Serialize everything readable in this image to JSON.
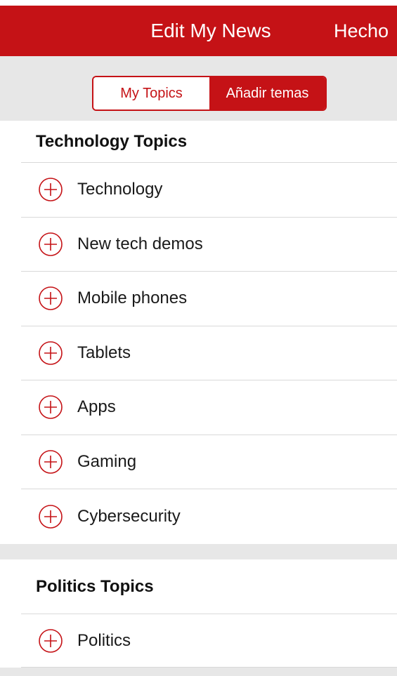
{
  "navbar": {
    "title": "Edit My News",
    "done_label": "Hecho",
    "color": "#c51216"
  },
  "segmented": {
    "my_topics": "My Topics",
    "add_topics": "Añadir temas",
    "selected": "Añadir temas"
  },
  "sections": [
    {
      "title": "Technology Topics",
      "items": [
        {
          "label": "Technology",
          "icon": "plus-circle-icon"
        },
        {
          "label": "New tech demos",
          "icon": "plus-circle-icon"
        },
        {
          "label": "Mobile phones",
          "icon": "plus-circle-icon"
        },
        {
          "label": "Tablets",
          "icon": "plus-circle-icon"
        },
        {
          "label": "Apps",
          "icon": "plus-circle-icon"
        },
        {
          "label": "Gaming",
          "icon": "plus-circle-icon"
        },
        {
          "label": "Cybersecurity",
          "icon": "plus-circle-icon"
        }
      ]
    },
    {
      "title": "Politics Topics",
      "items": [
        {
          "label": "Politics",
          "icon": "plus-circle-icon"
        }
      ]
    }
  ]
}
